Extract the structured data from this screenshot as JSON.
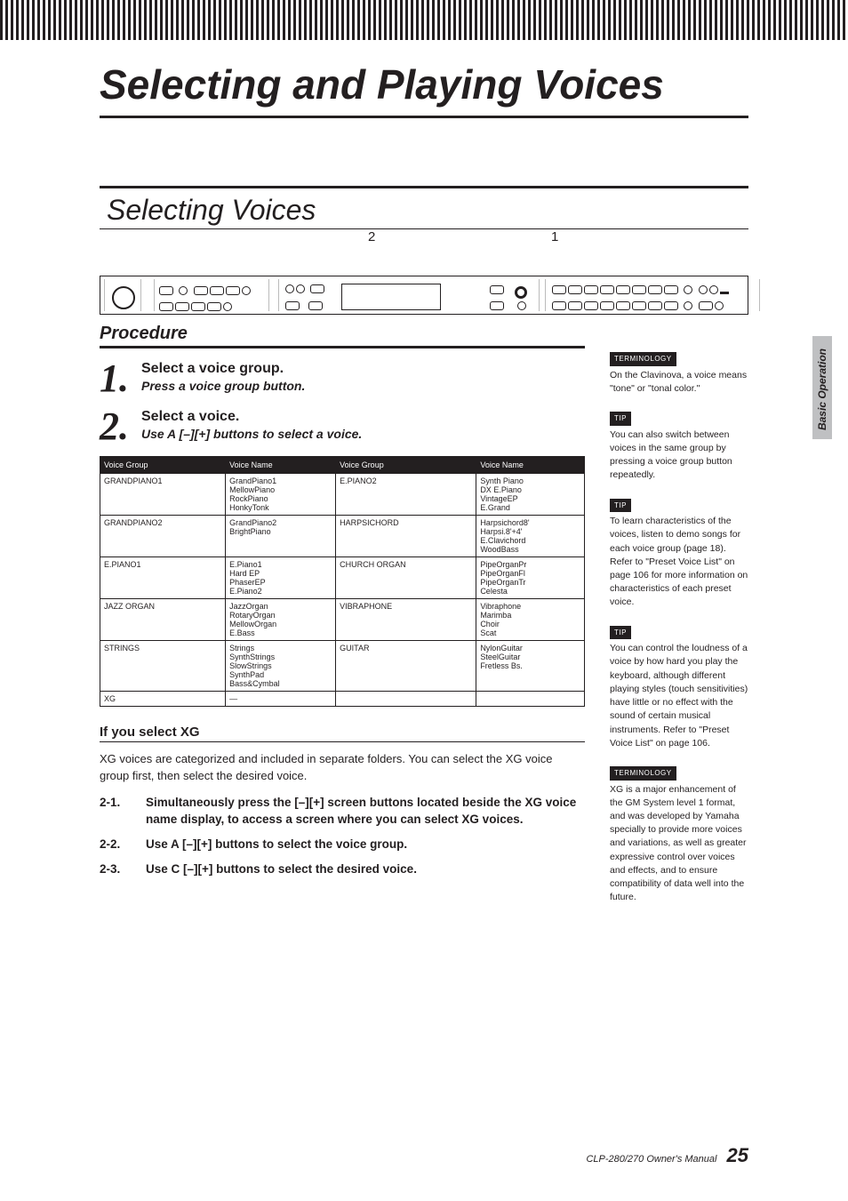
{
  "sidebar_tab": "Basic Operation",
  "page_title": "Selecting and Playing Voices",
  "section_title": "Selecting Voices",
  "callout_2": "2",
  "callout_1": "1",
  "procedure_label": "Procedure",
  "steps": [
    {
      "num": "1.",
      "title": "Select a voice group.",
      "sub": "Press a voice group button."
    },
    {
      "num": "2.",
      "title": "Select a voice.",
      "sub": "Use A [–][+] buttons to select a voice."
    }
  ],
  "table_headers": [
    "Voice Group",
    "Voice Name",
    "Voice Group",
    "Voice Name"
  ],
  "table_rows": [
    [
      "GRANDPIANO1",
      "GrandPiano1\nMellowPiano\nRockPiano\nHonkyTonk",
      "E.PIANO2",
      "Synth Piano\nDX E.Piano\nVintageEP\nE.Grand"
    ],
    [
      "GRANDPIANO2",
      "GrandPiano2\nBrightPiano",
      "HARPSICHORD",
      "Harpsichord8'\nHarpsi.8'+4'\nE.Clavichord\nWoodBass"
    ],
    [
      "E.PIANO1",
      "E.Piano1\nHard EP\nPhaserEP\nE.Piano2",
      "CHURCH ORGAN",
      "PipeOrganPr\nPipeOrganFl\nPipeOrganTr\nCelesta"
    ],
    [
      "JAZZ ORGAN",
      "JazzOrgan\nRotaryOrgan\nMellowOrgan\nE.Bass",
      "VIBRAPHONE",
      "Vibraphone\nMarimba\nChoir\nScat"
    ],
    [
      "STRINGS",
      "Strings\nSynthStrings\nSlowStrings\nSynthPad\nBass&Cymbal",
      "GUITAR",
      "NylonGuitar\nSteelGuitar\nFretless Bs."
    ],
    [
      "XG",
      "—",
      "",
      ""
    ]
  ],
  "xg": {
    "heading": "If you select XG",
    "text": "XG voices are categorized and included in separate folders. You can select the XG voice group first, then select the desired voice.",
    "substeps": [
      {
        "n": "2-1.",
        "t": "Simultaneously press the [–][+] screen buttons located beside the XG voice name display, to access a screen where you can select XG voices."
      },
      {
        "n": "2-2.",
        "t": "Use A [–][+] buttons to select the voice group."
      },
      {
        "n": "2-3.",
        "t": "Use C [–][+] buttons to select the desired voice."
      }
    ]
  },
  "tips": [
    {
      "label": "TERMINOLOGY",
      "text": "On the Clavinova, a voice means \"tone\" or \"tonal color.\""
    },
    {
      "label": "TIP",
      "text": "You can also switch between voices in the same group by pressing a voice group button repeatedly."
    },
    {
      "label": "TIP",
      "text": "To learn characteristics of the voices, listen to demo songs for each voice group (page 18). Refer to \"Preset Voice List\" on page 106 for more information on characteristics of each preset voice."
    },
    {
      "label": "TIP",
      "text": "You can control the loudness of a voice by how hard you play the keyboard, although different playing styles (touch sensitivities) have little or no effect with the sound of certain musical instruments. Refer to \"Preset Voice List\" on page 106."
    },
    {
      "label": "TERMINOLOGY",
      "text": "XG is a major enhancement of the GM System level 1 format, and was developed by Yamaha specially to provide more voices and variations, as well as greater expressive control over voices and effects, and to ensure compatibility of data well into the future."
    }
  ],
  "footer_text": "CLP-280/270 Owner's Manual",
  "page_number": "25"
}
